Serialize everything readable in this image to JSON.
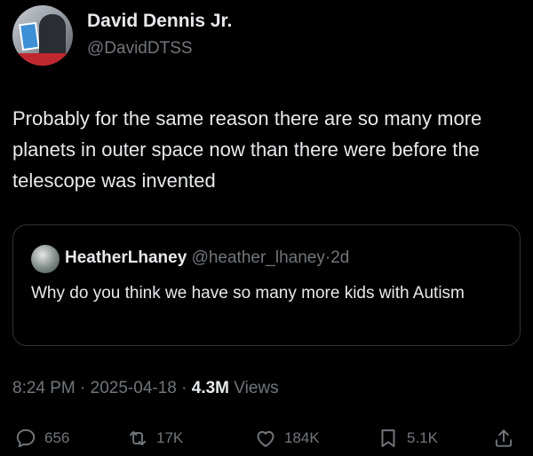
{
  "author": {
    "name": "David Dennis Jr.",
    "handle": "@DavidDTSS"
  },
  "tweet": {
    "text": "Probably for the same reason there are so many more planets in outer space now than there were before the telescope was invented"
  },
  "quoted": {
    "name": "HeatherLhaney",
    "handle": "@heather_lhaney",
    "separator": "·",
    "age": "2d",
    "text": "Why do you think we have so many more kids with Autism"
  },
  "meta": {
    "time": "8:24 PM",
    "separator": "·",
    "date": "2025-04-18",
    "views_count": "4.3M",
    "views_label": "Views"
  },
  "actions": {
    "replies": "656",
    "reposts": "17K",
    "likes": "184K",
    "bookmarks": "5.1K"
  },
  "icons": {
    "reply": "reply-icon",
    "repost": "repost-icon",
    "like": "heart-icon",
    "bookmark": "bookmark-icon",
    "share": "share-icon"
  },
  "colors": {
    "background": "#000000",
    "text": "#e7e9ea",
    "secondary": "#71767b",
    "border": "#2f3336"
  }
}
